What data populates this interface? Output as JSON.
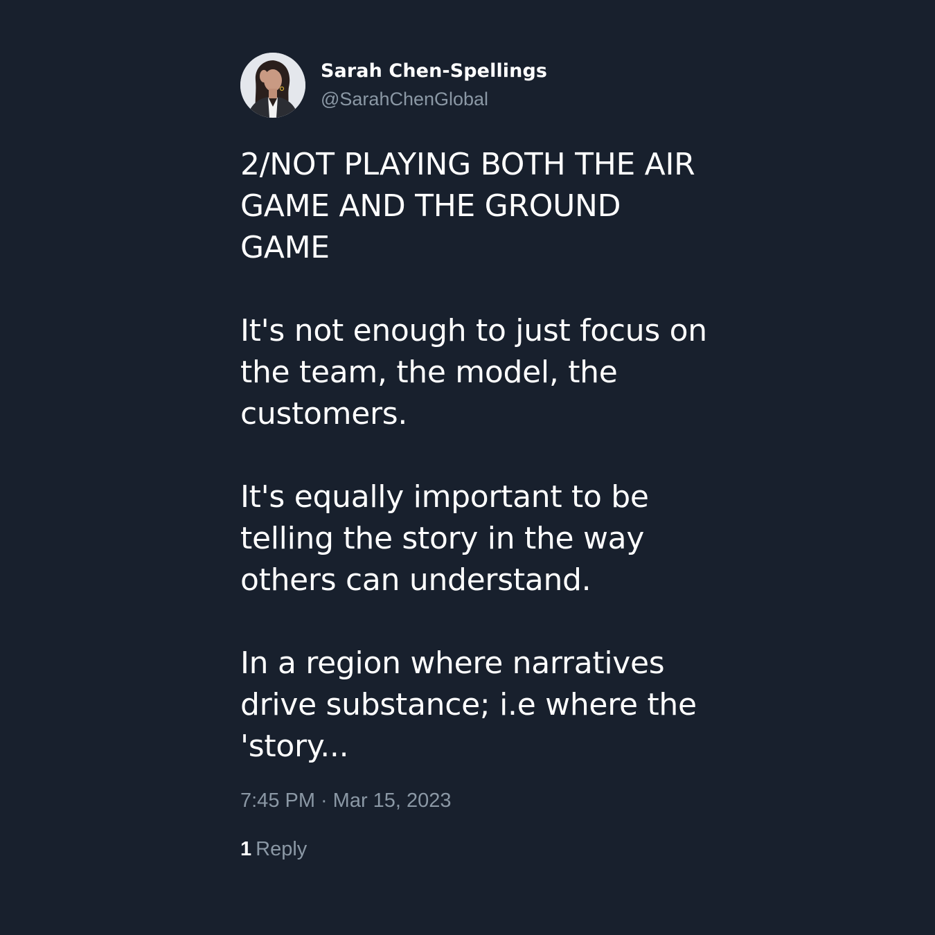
{
  "author": {
    "display_name": "Sarah Chen-Spellings",
    "handle": "@SarahChenGlobal",
    "avatar_icon": "profile-photo-avatar"
  },
  "tweet": {
    "paragraphs": [
      "2/NOT PLAYING BOTH THE AIR\nGAME AND THE GROUND\nGAME",
      "It's not enough to just focus on\nthe team, the model, the\ncustomers.",
      "It's equally important to be\ntelling the story in the way\nothers can understand.",
      "In a region where narratives\ndrive substance; i.e where the\n'story..."
    ],
    "time": "7:45 PM",
    "separator": "·",
    "date": "Mar 15, 2023",
    "reply_count": "1",
    "reply_label": "Reply"
  },
  "colors": {
    "background": "#18202d",
    "primary_text": "#ffffff",
    "secondary_text": "#8b98a5"
  }
}
